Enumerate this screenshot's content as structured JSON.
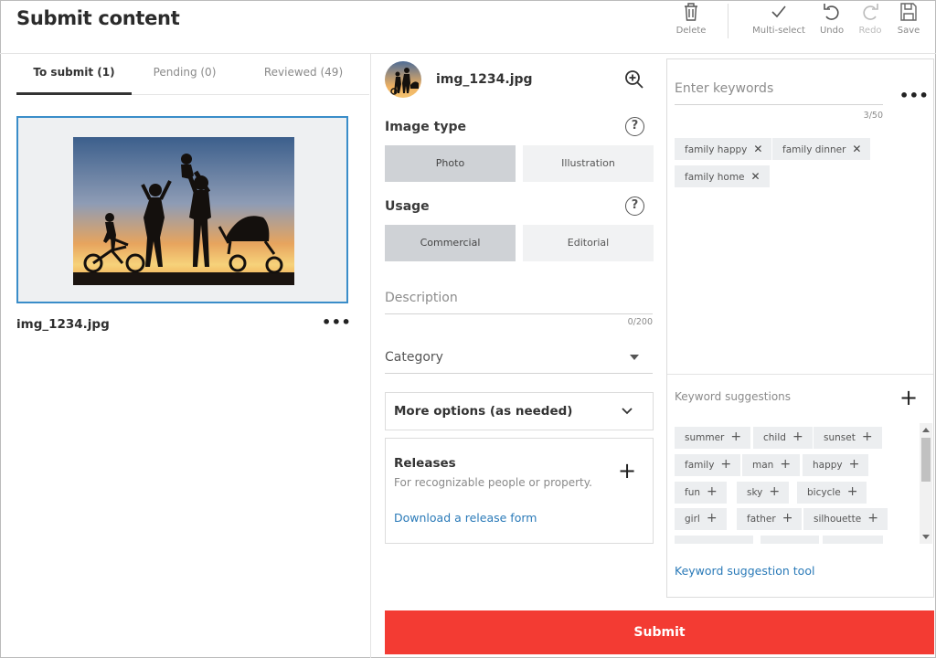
{
  "header": {
    "title": "Submit content",
    "toolbar": {
      "delete": "Delete",
      "multi_select": "Multi-select",
      "undo": "Undo",
      "redo": "Redo",
      "save": "Save"
    }
  },
  "left": {
    "tabs": [
      "To submit (1)",
      "Pending (0)",
      "Reviewed (49)"
    ],
    "file_name": "img_1234.jpg"
  },
  "middle": {
    "file_name": "img_1234.jpg",
    "image_type": {
      "label": "Image type",
      "options": [
        "Photo",
        "Illustration"
      ],
      "selected": "Photo"
    },
    "usage": {
      "label": "Usage",
      "options": [
        "Commercial",
        "Editorial"
      ],
      "selected": "Commercial"
    },
    "description": {
      "placeholder": "Description",
      "counter": "0/200"
    },
    "category": {
      "placeholder": "Category"
    },
    "more_options": "More options (as needed)",
    "releases": {
      "title": "Releases",
      "subtitle": "For recognizable people or property.",
      "link": "Download a release form"
    },
    "submit": "Submit"
  },
  "right": {
    "keywords": {
      "placeholder": "Enter keywords",
      "counter": "3/50",
      "items": [
        "family happy",
        "family dinner",
        "family home"
      ]
    },
    "suggestions": {
      "label": "Keyword suggestions",
      "items": [
        "summer",
        "child",
        "sunset",
        "family",
        "man",
        "happy",
        "fun",
        "sky",
        "bicycle",
        "girl",
        "father",
        "silhouette"
      ],
      "tool_link": "Keyword suggestion tool"
    }
  },
  "icons": {
    "help": "?",
    "remove": "✕",
    "add": "+"
  },
  "colors": {
    "accent": "#3a8dc9",
    "link": "#2a7ab8",
    "submit": "#f33b33"
  }
}
